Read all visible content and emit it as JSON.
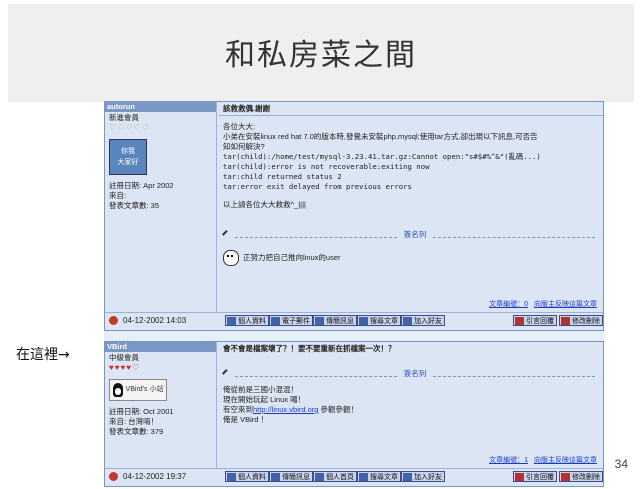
{
  "slide": {
    "title": "和私房菜之間",
    "page_number": "34",
    "annotation": "在這裡→"
  },
  "post1": {
    "username": "autorun",
    "rank": "新進會員",
    "stars": "♡♡♡♡♡",
    "avatar_text_1": "你我",
    "avatar_text_2": "大家好",
    "reg_date": "註冊日期: Apr 2002",
    "from": "來自:",
    "post_count": "發表文章數: 35",
    "title": "該救救偶.謝謝",
    "lines": [
      "各位大大:",
      "小弟在安裝linux red hat 7.0的版本時,發覺未安裝php,mysql;使用tar方式,卻出現以下訊息,可否告",
      "知如何解決?"
    ],
    "mono_lines": [
      "tar(child):/home/test/mysql-3.23.41.tar.gz:Cannot open:\"s#$#%^&\"(亂碼...)",
      "tar(child):error is not recoverable:exiting now",
      "tar:child returned status 2",
      "tar:error exit delayed from previous errors"
    ],
    "closing": "以上請各位大大救救^_||||",
    "sig_label": "簽名列",
    "sig_text": "正努力把自己推向linux的user",
    "footlinks": [
      "文章編號：0",
      "向版主反映這篇文章"
    ],
    "date": "04-12-2002 14:03",
    "buttons": [
      "個人資料",
      "電子郵件",
      "傳簡訊息",
      "搜尋文章",
      "加入好友",
      "引言回覆",
      "修改刪除"
    ]
  },
  "post2": {
    "username": "VBird",
    "rank": "中級會員",
    "stars": "♥♥♥♥♡",
    "avatar_text": "VBird's 小站",
    "reg_date": "註冊日期: Oct 2001",
    "from": "來自: 台灣唷！",
    "post_count": "發表文章數: 379",
    "title": "會不會是檔案壞了？！要不要重新在抓檔案一次！？",
    "sig_label": "簽名列",
    "sig_lines": [
      "俺從前是三國小混混！",
      "現在開始玩起 Linux 囉！"
    ],
    "sig_link_prefix": "有空來到",
    "sig_link": "http://linux.vbird.org",
    "sig_link_suffix": " 參觀參觀！",
    "sig_name": "俺是 VBird ！",
    "footlinks": [
      "文章編號：1",
      "向版主反映這篇文章"
    ],
    "date": "04-12-2002 19:37",
    "buttons": [
      "個人資料",
      "傳簡訊息",
      "個人首頁",
      "搜尋文章",
      "加入好友",
      "引言回覆",
      "修改刪除"
    ]
  }
}
